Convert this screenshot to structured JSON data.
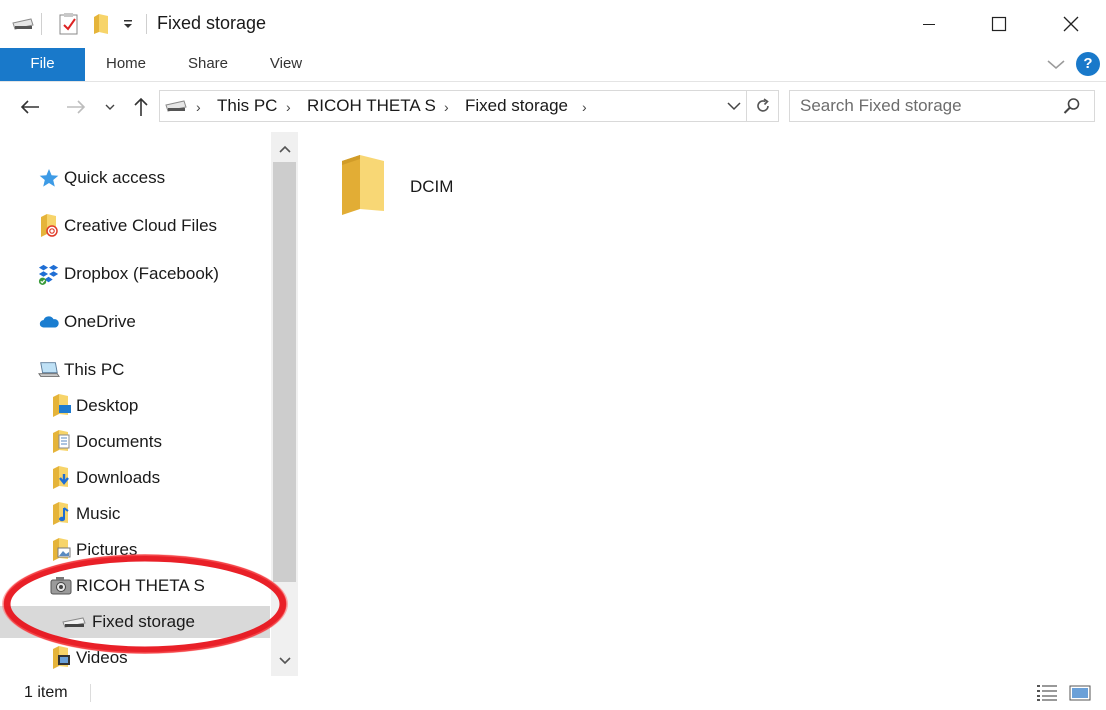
{
  "window": {
    "title": "Fixed storage",
    "controls": {
      "minimize": "─",
      "maximize": "☐",
      "close": "✕"
    }
  },
  "ribbon": {
    "tabs": [
      {
        "label": "File"
      },
      {
        "label": "Home"
      },
      {
        "label": "Share"
      },
      {
        "label": "View"
      }
    ],
    "help_label": "?"
  },
  "address": {
    "breadcrumbs": [
      "This PC",
      "RICOH THETA S",
      "Fixed storage"
    ],
    "search_placeholder": "Search Fixed storage"
  },
  "navpane": {
    "items": [
      {
        "label": "Quick access",
        "icon": "star-icon"
      },
      {
        "label": "Creative Cloud Files",
        "icon": "creative-cloud-folder-icon"
      },
      {
        "label": "Dropbox (Facebook)",
        "icon": "dropbox-icon"
      },
      {
        "label": "OneDrive",
        "icon": "onedrive-cloud-icon"
      },
      {
        "label": "This PC",
        "icon": "computer-icon"
      },
      {
        "label": "Desktop",
        "icon": "desktop-folder-icon"
      },
      {
        "label": "Documents",
        "icon": "documents-folder-icon"
      },
      {
        "label": "Downloads",
        "icon": "downloads-folder-icon"
      },
      {
        "label": "Music",
        "icon": "music-folder-icon"
      },
      {
        "label": "Pictures",
        "icon": "pictures-folder-icon"
      },
      {
        "label": "RICOH THETA S",
        "icon": "camera-icon"
      },
      {
        "label": "Fixed storage",
        "icon": "drive-icon",
        "selected": true
      },
      {
        "label": "Videos",
        "icon": "videos-folder-icon"
      }
    ]
  },
  "content": {
    "items": [
      {
        "name": "DCIM",
        "icon": "folder-icon"
      }
    ]
  },
  "status": {
    "item_count": "1 item"
  },
  "colors": {
    "accent": "#1979ca",
    "selection": "#d9d9d9",
    "annotation": "#e8141c",
    "folder": "#f4c84a"
  }
}
